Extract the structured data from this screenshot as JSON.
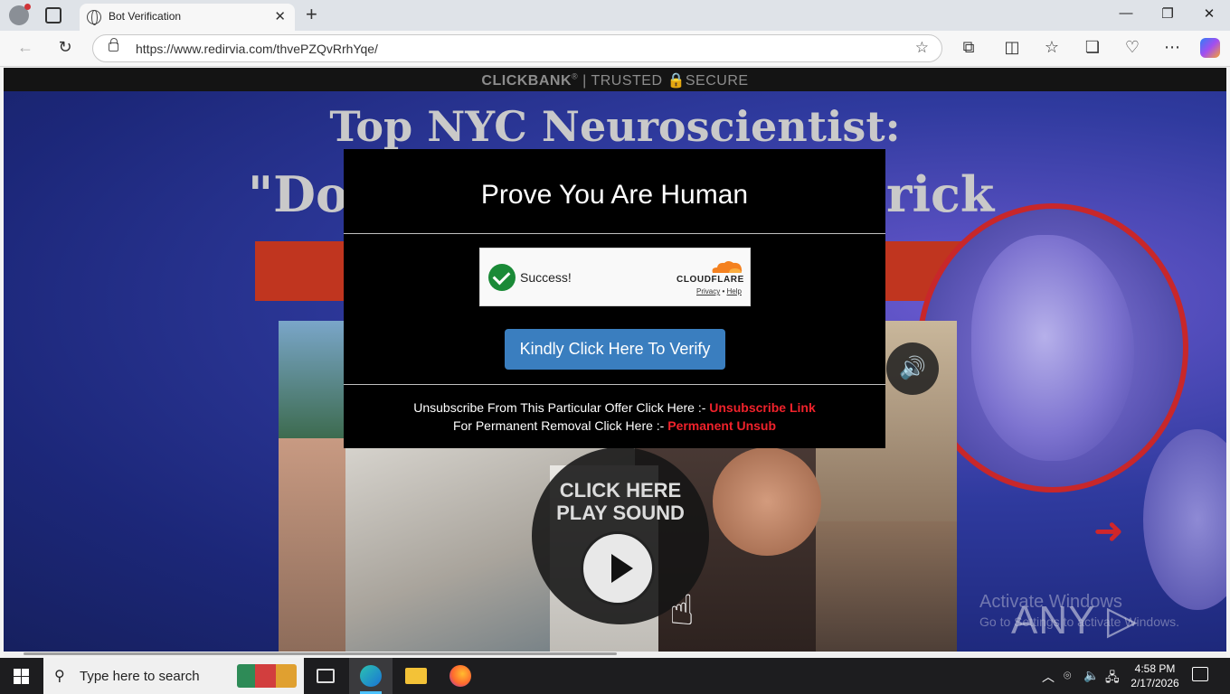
{
  "browser": {
    "tab_title": "Bot Verification",
    "tab_close": "✕",
    "new_tab": "+",
    "url": "https://www.redirvia.com/thvePZQvRrhYqe/",
    "window_controls": {
      "minimize": "—",
      "restore": "❐",
      "close": "✕"
    },
    "nav_icons": {
      "back": "←",
      "refresh": "↻",
      "favorite": "☆"
    },
    "toolbar_icons": [
      "extensions-icon",
      "split-screen-icon",
      "favorites-icon",
      "collections-icon",
      "browser-essentials-icon",
      "more-icon",
      "copilot-icon"
    ],
    "toolbar_glyphs": [
      "⧉",
      "◫",
      "☆",
      "❏",
      "♡",
      "⋯"
    ]
  },
  "page": {
    "banner": {
      "brand": "CLICKBANK",
      "reg": "®",
      "divider": "|",
      "trusted": "TRUSTED",
      "secure": "SECURE"
    },
    "headline_line1": "Top NYC Neuroscientist:",
    "headline_line2_left": "\"Do",
    "headline_line2_right": "rick",
    "play_overlay": {
      "line1": "CLICK HERE",
      "line2": "PLAY SOUND"
    },
    "speaker_glyph": "🔊",
    "hand_glyph": "☝",
    "arrow_glyph": "➜",
    "watermark": {
      "title": "Activate Windows",
      "subtitle": "Go to Settings to activate Windows."
    },
    "anyrun": "ANY ▷ RUN"
  },
  "modal": {
    "title": "Prove You Are Human",
    "captcha": {
      "status": "Success!",
      "brand": "CLOUDFLARE",
      "privacy": "Privacy",
      "separator": "•",
      "help": "Help"
    },
    "verify_button": "Kindly Click Here To Verify",
    "unsub_line1_text": "Unsubscribe From This Particular Offer Click Here :-",
    "unsub_line1_link": "Unsubscribe Link",
    "unsub_line2_text": "For Permanent Removal Click Here :-",
    "unsub_line2_link": "Permanent Unsub"
  },
  "taskbar": {
    "search_placeholder": "Type here to search",
    "search_glyph": "⚲",
    "tray_glyphs": {
      "chevron": "︿",
      "meet": "⌾",
      "volume": "🔈",
      "network": "🖧"
    },
    "time": "4:58 PM",
    "date": "2/17/2026"
  },
  "colors": {
    "verify_button": "#3a7ebf",
    "unsub_link": "#f0222b",
    "captcha_success": "#1a8a37",
    "cloudflare_orange": "#f48120"
  }
}
